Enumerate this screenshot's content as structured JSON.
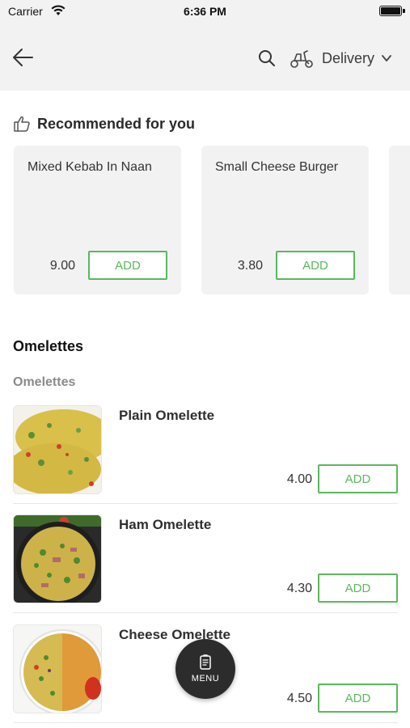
{
  "status_bar": {
    "carrier": "Carrier",
    "time": "6:36 PM",
    "icons": [
      "wifi-icon",
      "battery-icon"
    ]
  },
  "header": {
    "icons": [
      "arrow-left-icon",
      "search-icon",
      "scooter-icon",
      "chevron-down-icon"
    ],
    "delivery_label": "Delivery"
  },
  "recommended": {
    "title": "Recommended for you",
    "icon": "thumbs-up-icon",
    "items": [
      {
        "name": "Mixed Kebab In Naan",
        "price": "9.00",
        "add_label": "ADD"
      },
      {
        "name": "Small Cheese Burger",
        "price": "3.80",
        "add_label": "ADD"
      }
    ]
  },
  "section": {
    "title": "Omelettes",
    "subtitle": "Omelettes",
    "items": [
      {
        "name": "Plain Omelette",
        "price": "4.00",
        "add_label": "ADD"
      },
      {
        "name": "Ham Omelette",
        "price": "4.30",
        "add_label": "ADD"
      },
      {
        "name": "Cheese Omelette",
        "price": "4.50",
        "add_label": "ADD"
      }
    ]
  },
  "menu_fab": {
    "label": "MENU",
    "icon": "menu-book-icon"
  },
  "colors": {
    "accent": "#5cb85c",
    "header_bg": "#f2f2f2",
    "fab_bg": "#2c2c2c"
  }
}
